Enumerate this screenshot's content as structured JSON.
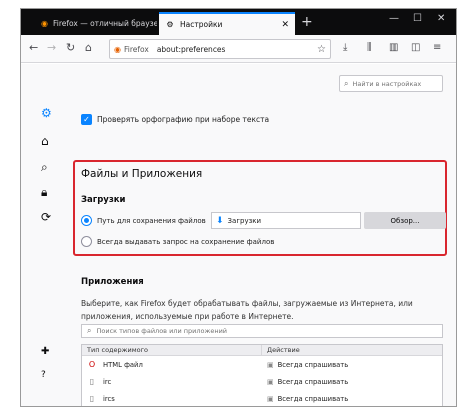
{
  "tabs": [
    {
      "label": "Firefox — отличный браузер д",
      "active": false
    },
    {
      "label": "Настройки",
      "active": true
    }
  ],
  "nav": {
    "brand": "Firefox",
    "url": "about:preferences"
  },
  "search_prefs": {
    "placeholder": "Найти в настройках"
  },
  "spell": {
    "label": "Проверять орфографию при наборе текста",
    "checked": true
  },
  "files_apps": {
    "title": "Файлы и Приложения",
    "downloads_title": "Загрузки",
    "save_path_label": "Путь для сохранения файлов",
    "folder": "Загрузки",
    "browse_label": "Обзор...",
    "always_ask_label": "Всегда выдавать запрос на сохранение файлов"
  },
  "apps": {
    "title": "Приложения",
    "description": "Выберите, как Firefox будет обрабатывать файлы, загружаемые из Интернета, или приложения, используемые при работе в Интернете.",
    "search_placeholder": "Поиск типов файлов или приложений",
    "columns": [
      "Тип содержимого",
      "Действие"
    ],
    "rows": [
      {
        "type": "HTML файл",
        "action": "Всегда спрашивать"
      },
      {
        "type": "irc",
        "action": "Всегда спрашивать"
      },
      {
        "type": "ircs",
        "action": "Всегда спрашивать"
      }
    ]
  },
  "colors": {
    "accent": "#0a84ff",
    "highlight": "#d9262e"
  }
}
